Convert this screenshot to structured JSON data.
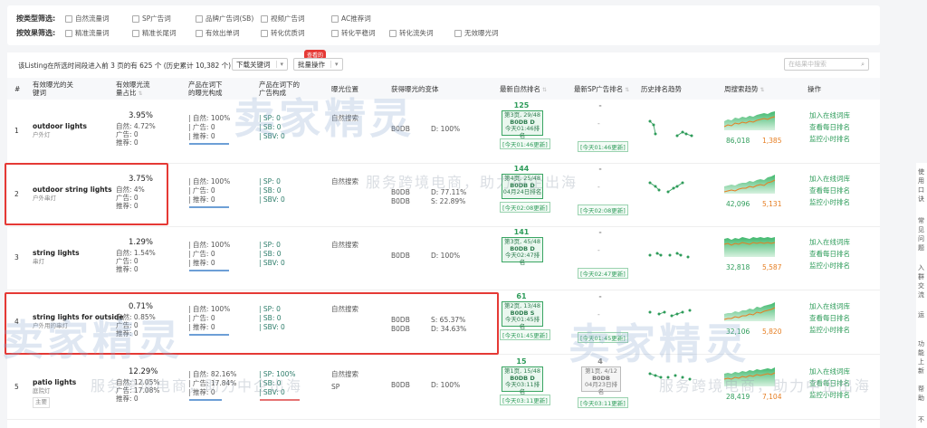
{
  "filters": {
    "type_label": "按类型筛选:",
    "type_options": [
      "自然流量词",
      "SP广告词",
      "品牌广告词(SB)",
      "视频广告词",
      "AC推荐词"
    ],
    "effect_label": "按效果筛选:",
    "effect_options": [
      "精准流量词",
      "精准长尾词",
      "有效出单词",
      "转化优质词",
      "转化平稳词",
      "转化流失词",
      "无效曝光词"
    ]
  },
  "toolbar": {
    "summary": "该Listing在所选时间段进入前 3 页的有 625 个 (历史累计 10,382 个)",
    "download_label": "下载关键词",
    "batch_label": "批量操作",
    "new_badge": "查看的",
    "search_placeholder": "在结果中搜索"
  },
  "columns": {
    "idx": "#",
    "keyword": "有效曝光的关键词",
    "share": "有效曝光流量占比",
    "composition": "产品在词下的曝光构成",
    "ad_composition": "产品在词下的广告构成",
    "position": "曝光位置",
    "variant": "获得曝光的变体",
    "natural_rank": "最新自然排名",
    "sp_rank": "最新SP广告排名",
    "history": "历史排名趋势",
    "search_trend": "周搜索趋势",
    "action": "操作"
  },
  "actions": [
    "加入在线词库",
    "查看每日排名",
    "监控小时排名"
  ],
  "rows": [
    {
      "idx": "1",
      "keyword": "outdoor lights",
      "keyword_cn": "户外灯",
      "tag": "",
      "share": "3.95%",
      "s_natural": "自然: 4.72%",
      "s_ad": "广告: 0",
      "s_rec": "推荐: 0",
      "c_natural": "自然: 100%",
      "c_ad": "广告: 0",
      "c_rec": "推荐: 0",
      "sp": "SP: 0",
      "sb": "SB: 0",
      "sbv": "SBV: 0",
      "position": "自然搜索",
      "variant": "B0DB",
      "variant_pct": "D: 100%",
      "variant2": "",
      "variant2_pct": "",
      "rank_top": "125",
      "rank_page": "第3页, 29/48",
      "rank_asin": "B0DB",
      "rank_suffix": "D",
      "rank_time": "今天01:46排名",
      "rank_update": "[今天01:46更新]",
      "sp_top": "-",
      "sp_update": "[今天01:46更新]",
      "trend_green": "86,018",
      "trend_orange": "1,385"
    },
    {
      "idx": "2",
      "keyword": "outdoor string lights",
      "keyword_cn": "户外串灯",
      "tag": "",
      "share": "3.75%",
      "s_natural": "自然: 4%",
      "s_ad": "广告: 0",
      "s_rec": "推荐: 0",
      "c_natural": "自然: 100%",
      "c_ad": "广告: 0",
      "c_rec": "推荐: 0",
      "sp": "SP: 0",
      "sb": "SB: 0",
      "sbv": "SBV: 0",
      "position": "自然搜索",
      "variant": "B0DB",
      "variant_pct": "D: 77.11%",
      "variant2": "B0DB",
      "variant2_pct": "S: 22.89%",
      "rank_top": "144",
      "rank_page": "第4页, 25/48",
      "rank_asin": "B0DB",
      "rank_suffix": "D",
      "rank_time": "04月24日排名",
      "rank_update": "[今天02:08更新]",
      "sp_top": "-",
      "sp_update": "[今天02:08更新]",
      "trend_green": "42,096",
      "trend_orange": "5,131"
    },
    {
      "idx": "3",
      "keyword": "string lights",
      "keyword_cn": "串灯",
      "tag": "",
      "share": "1.29%",
      "s_natural": "自然: 1.54%",
      "s_ad": "广告: 0",
      "s_rec": "推荐: 0",
      "c_natural": "自然: 100%",
      "c_ad": "广告: 0",
      "c_rec": "推荐: 0",
      "sp": "SP: 0",
      "sb": "SB: 0",
      "sbv": "SBV: 0",
      "position": "自然搜索",
      "variant": "B0DB",
      "variant_pct": "D: 100%",
      "variant2": "",
      "variant2_pct": "",
      "rank_top": "141",
      "rank_page": "第3页, 45/48",
      "rank_asin": "B0DB",
      "rank_suffix": "D",
      "rank_time": "今天02:47排名",
      "rank_update": "",
      "sp_top": "-",
      "sp_update": "[今天02:47更新]",
      "trend_green": "32,818",
      "trend_orange": "5,587"
    },
    {
      "idx": "4",
      "keyword": "string lights for outside",
      "keyword_cn": "户外用的串灯",
      "tag": "",
      "share": "0.71%",
      "s_natural": "自然: 0.85%",
      "s_ad": "广告: 0",
      "s_rec": "推荐: 0",
      "c_natural": "自然: 100%",
      "c_ad": "广告: 0",
      "c_rec": "推荐: 0",
      "sp": "SP: 0",
      "sb": "SB: 0",
      "sbv": "SBV: 0",
      "position": "自然搜索",
      "variant": "B0DB",
      "variant_pct": "S: 65.37%",
      "variant2": "B0DB",
      "variant2_pct": "D: 34.63%",
      "rank_top": "61",
      "rank_page": "第2页, 13/48",
      "rank_asin": "B0DB",
      "rank_suffix": "S",
      "rank_time": "今天01:45排名",
      "rank_update": "[今天01:45更新]",
      "sp_top": "-",
      "sp_update": "[今天01:45更新]",
      "trend_green": "32,106",
      "trend_orange": "5,820"
    },
    {
      "idx": "5",
      "keyword": "patio lights",
      "keyword_cn": "庭院灯",
      "tag": "主要",
      "share": "12.29%",
      "s_natural": "自然: 12.05%",
      "s_ad": "广告: 17.08%",
      "s_rec": "推荐: 0",
      "c_natural": "自然: 82.16%",
      "c_ad": "广告: 17.84%",
      "c_rec": "推荐: 0",
      "sp": "SP: 100%",
      "sb": "SB: 0",
      "sbv": "SBV: 0",
      "position": "自然搜索",
      "position2": "SP",
      "variant": "B0DB",
      "variant_pct": "D: 100%",
      "variant2": "",
      "variant2_pct": "",
      "rank_top": "15",
      "rank_page": "第1页, 15/48",
      "rank_asin": "B0DB",
      "rank_suffix": "D",
      "rank_time": "今天03:11排名",
      "rank_update": "[今天03:11更新]",
      "sp_top": "4",
      "sp_page": "第1页, 4/12",
      "sp_asin": "B0DB",
      "sp_time": "04月23日排名",
      "sp_update": "[今天03:11更新]",
      "trend_green": "28,419",
      "trend_orange": "7,104"
    }
  ],
  "watermark": {
    "logo": "卖家精灵",
    "slogan": "服务跨境电商，助力中企出海"
  },
  "colors": {
    "accent_green": "#2e9c5a",
    "orange": "#e67e22",
    "highlight_red": "#e53935",
    "bar_blue": "#6d9fd6"
  }
}
